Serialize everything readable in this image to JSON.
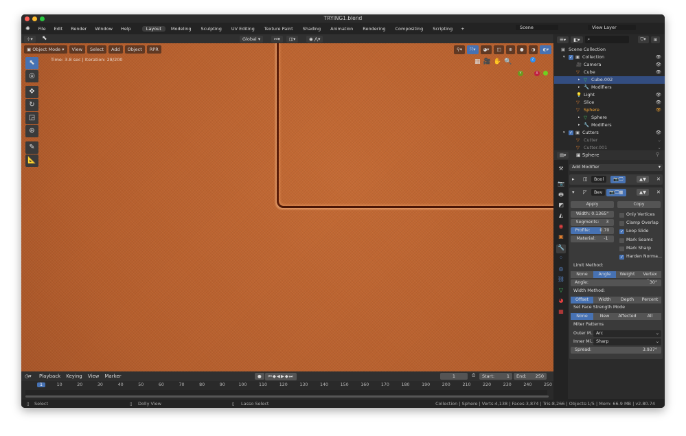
{
  "window": {
    "title": "TRYING1.blend"
  },
  "menu": [
    "File",
    "Edit",
    "Render",
    "Window",
    "Help"
  ],
  "workspaces": [
    "Layout",
    "Modeling",
    "Sculpting",
    "UV Editing",
    "Texture Paint",
    "Shading",
    "Animation",
    "Rendering",
    "Compositing",
    "Scripting"
  ],
  "scene": "Scene",
  "view_layer": "View Layer",
  "header": {
    "orientation": "Global"
  },
  "viewport": {
    "mode": "Object Mode",
    "menus": [
      "View",
      "Select",
      "Add",
      "Object",
      "RPR"
    ],
    "render_info": "Time: 3.8 sec | Iteration: 28/200",
    "axes": [
      "Z",
      "Y",
      "X"
    ]
  },
  "outliner": {
    "search_placeholder": "",
    "rows": [
      {
        "label": "Scene Collection",
        "depth": 0,
        "icon": "scene-collection-icon"
      },
      {
        "label": "Collection",
        "depth": 1,
        "icon": "collection-icon"
      },
      {
        "label": "Camera",
        "depth": 2,
        "icon": "camera-icon"
      },
      {
        "label": "Cube",
        "depth": 2,
        "icon": "mesh-object-icon"
      },
      {
        "label": "Cube.002",
        "depth": 3,
        "icon": "mesh-data-icon",
        "selected": true
      },
      {
        "label": "Modifiers",
        "depth": 3,
        "icon": "wrench-icon"
      },
      {
        "label": "Light",
        "depth": 2,
        "icon": "light-icon"
      },
      {
        "label": "Slice",
        "depth": 2,
        "icon": "mesh-object-icon"
      },
      {
        "label": "Sphere",
        "depth": 2,
        "icon": "mesh-object-icon",
        "active": true
      },
      {
        "label": "Sphere",
        "depth": 3,
        "icon": "mesh-data-icon"
      },
      {
        "label": "Modifiers",
        "depth": 3,
        "icon": "wrench-icon"
      },
      {
        "label": "Cutters",
        "depth": 1,
        "icon": "collection-icon"
      },
      {
        "label": "Cutter",
        "depth": 2,
        "icon": "mesh-object-icon",
        "dim": true
      },
      {
        "label": "Cutter.001",
        "depth": 2,
        "icon": "mesh-object-icon",
        "dim": true
      }
    ]
  },
  "properties": {
    "object": "Sphere",
    "add_modifier": "Add Modifier",
    "modifiers": [
      {
        "name": "Bool"
      },
      {
        "name": "Bev"
      }
    ],
    "apply": "Apply",
    "copy": "Copy",
    "width": "Width:  0.1365\"",
    "segments_label": "Segments:",
    "segments": "3",
    "profile_label": "Profile:",
    "profile": "0.70",
    "profile_fraction": 0.7,
    "material_label": "Material:",
    "material": "-1",
    "checks": [
      {
        "label": "Only Vertices",
        "on": false
      },
      {
        "label": "Clamp Overlap",
        "on": false
      },
      {
        "label": "Loop Slide",
        "on": true
      },
      {
        "label": "Mark Seams",
        "on": false
      },
      {
        "label": "Mark Sharp",
        "on": false
      },
      {
        "label": "Harden Norma...",
        "on": true
      }
    ],
    "limit_method_label": "Limit Method:",
    "limit_methods": [
      "None",
      "Angle",
      "Weight",
      "Vertex G..."
    ],
    "limit_selected": 1,
    "angle_label": "Angle:",
    "angle": "30°",
    "width_method_label": "Width Method:",
    "width_methods": [
      "Offset",
      "Width",
      "Depth",
      "Percent"
    ],
    "width_selected": 0,
    "face_strength_label": "Set Face Strength Mode",
    "face_strength": [
      "None",
      "New",
      "Affected",
      "All"
    ],
    "face_selected": 0,
    "miter_label": "Miter Patterns",
    "outer_label": "Outer M...",
    "outer": "Arc",
    "inner_label": "Inner Mi...",
    "inner": "Sharp",
    "spread_label": "Spread:",
    "spread": "3.937°"
  },
  "timeline": {
    "menus": [
      "Playback",
      "Keying",
      "View",
      "Marker"
    ],
    "current_frame": "1",
    "start_label": "Start:",
    "start": "1",
    "end_label": "End:",
    "end": "250",
    "ticks": [
      "1",
      "10",
      "20",
      "30",
      "40",
      "50",
      "60",
      "70",
      "80",
      "90",
      "100",
      "110",
      "120",
      "130",
      "140",
      "150",
      "160",
      "170",
      "180",
      "190",
      "200",
      "210",
      "220",
      "230",
      "240",
      "250"
    ]
  },
  "status": {
    "select": "Select",
    "dolly": "Dolly View",
    "lasso": "Lasso Select",
    "stats": "Collection | Sphere | Verts:4,138 | Faces:3,874 | Tris:8,266 | Objects:1/5 | Mem: 66.9 MB | v2.80.74"
  },
  "colors": {
    "accent": "#4772b3",
    "viewport": "#b85f2d",
    "active_object": "#f0a030"
  }
}
